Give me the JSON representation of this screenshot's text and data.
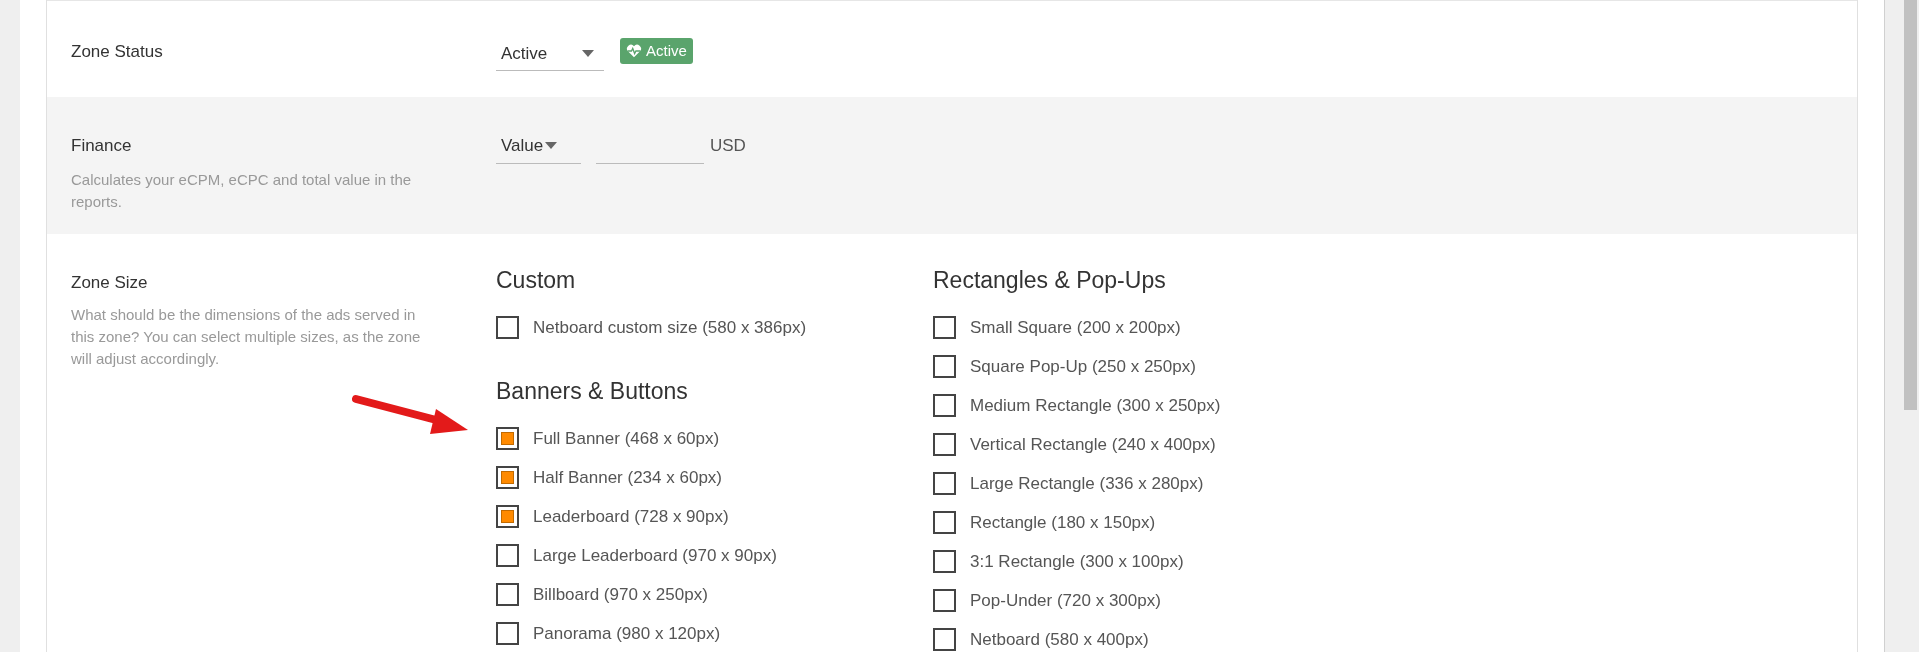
{
  "zone_status": {
    "label": "Zone Status",
    "select_value": "Active",
    "badge": "Active"
  },
  "finance": {
    "label": "Finance",
    "description": "Calculates your eCPM, eCPC and total value in the reports.",
    "select_value": "Value",
    "currency": "USD"
  },
  "zone_size": {
    "label": "Zone Size",
    "description": "What should be the dimensions of the ads served in this zone? You can select multiple sizes, as the zone will adjust accordingly.",
    "columns": [
      {
        "groups": [
          {
            "title": "Custom",
            "options": [
              {
                "label": "Netboard custom size (580 x 386px)",
                "checked": false
              }
            ]
          },
          {
            "title": "Banners & Buttons",
            "options": [
              {
                "label": "Full Banner (468 x 60px)",
                "checked": true
              },
              {
                "label": "Half Banner (234 x 60px)",
                "checked": true
              },
              {
                "label": "Leaderboard (728 x 90px)",
                "checked": true
              },
              {
                "label": "Large Leaderboard (970 x 90px)",
                "checked": false
              },
              {
                "label": "Billboard (970 x 250px)",
                "checked": false
              },
              {
                "label": "Panorama (980 x 120px)",
                "checked": false
              }
            ]
          }
        ]
      },
      {
        "groups": [
          {
            "title": "Rectangles & Pop-Ups",
            "options": [
              {
                "label": "Small Square (200 x 200px)",
                "checked": false
              },
              {
                "label": "Square Pop-Up (250 x 250px)",
                "checked": false
              },
              {
                "label": "Medium Rectangle (300 x 250px)",
                "checked": false
              },
              {
                "label": "Vertical Rectangle (240 x 400px)",
                "checked": false
              },
              {
                "label": "Large Rectangle (336 x 280px)",
                "checked": false
              },
              {
                "label": "Rectangle (180 x 150px)",
                "checked": false
              },
              {
                "label": "3:1 Rectangle (300 x 100px)",
                "checked": false
              },
              {
                "label": "Pop-Under (720 x 300px)",
                "checked": false
              },
              {
                "label": "Netboard (580 x 400px)",
                "checked": false
              }
            ]
          }
        ]
      }
    ]
  }
}
